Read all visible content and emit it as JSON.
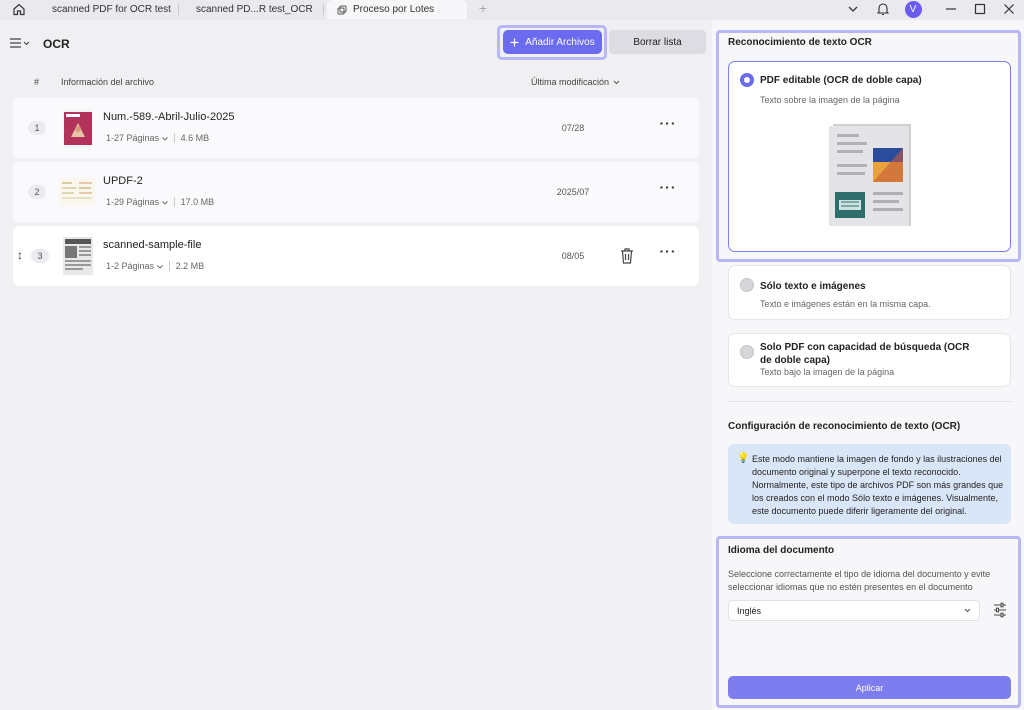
{
  "tabs": [
    {
      "label": "scanned PDF for OCR test"
    },
    {
      "label": "scanned PD...R test_OCR"
    },
    {
      "label": "Proceso por Lotes"
    }
  ],
  "new_tab_label": "+",
  "user": {
    "initial": "V"
  },
  "toolbar": {
    "title": "OCR",
    "add_files_label": "Añadir Archivos",
    "clear_list_label": "Borrar lista"
  },
  "table": {
    "headers": {
      "index": "#",
      "file_info": "Información del archivo",
      "modified": "Última modificación"
    },
    "rows": [
      {
        "index": "1",
        "name": "Num.-589.-Abril-Julio-2025",
        "pages": "1-27 Páginas",
        "size": "4.6 MB",
        "date": "07/28"
      },
      {
        "index": "2",
        "name": "UPDF-2",
        "pages": "1-29 Páginas",
        "size": "17.0 MB",
        "date": "2025/07"
      },
      {
        "index": "3",
        "name": "scanned-sample-file",
        "pages": "1-2 Páginas",
        "size": "2.2 MB",
        "date": "08/05"
      }
    ]
  },
  "ocr": {
    "section_title": "Reconocimiento de texto OCR",
    "options": [
      {
        "title": "PDF editable (OCR de doble capa)",
        "subtitle": "Texto sobre la imagen de la página",
        "selected": true
      },
      {
        "title": "Sólo texto e imágenes",
        "subtitle": "Texto e imágenes están en la misma capa.",
        "selected": false
      },
      {
        "title": "Solo PDF con capacidad de búsqueda (OCR de doble capa)",
        "subtitle": "Texto bajo la imagen de la página",
        "selected": false
      }
    ],
    "config_title": "Configuración de reconocimiento de texto (OCR)",
    "info_text": "Este modo mantiene la imagen de fondo y las ilustraciones del documento original y superpone el texto reconocido. Normalmente, este tipo de archivos PDF son más grandes que los creados con el modo Sólo texto e imágenes. Visualmente, este documento puede diferir ligeramente del original."
  },
  "language": {
    "title": "Idioma del documento",
    "description": "Seleccione correctamente el tipo de idioma del documento y evite seleccionar idiomas que no estén presentes en el documento",
    "selected": "Inglés"
  },
  "apply_label": "Aplicar",
  "colors": {
    "accent": "#6b6bf0",
    "highlight": "#b8b6f5",
    "info_bg": "#d9e6f8"
  }
}
